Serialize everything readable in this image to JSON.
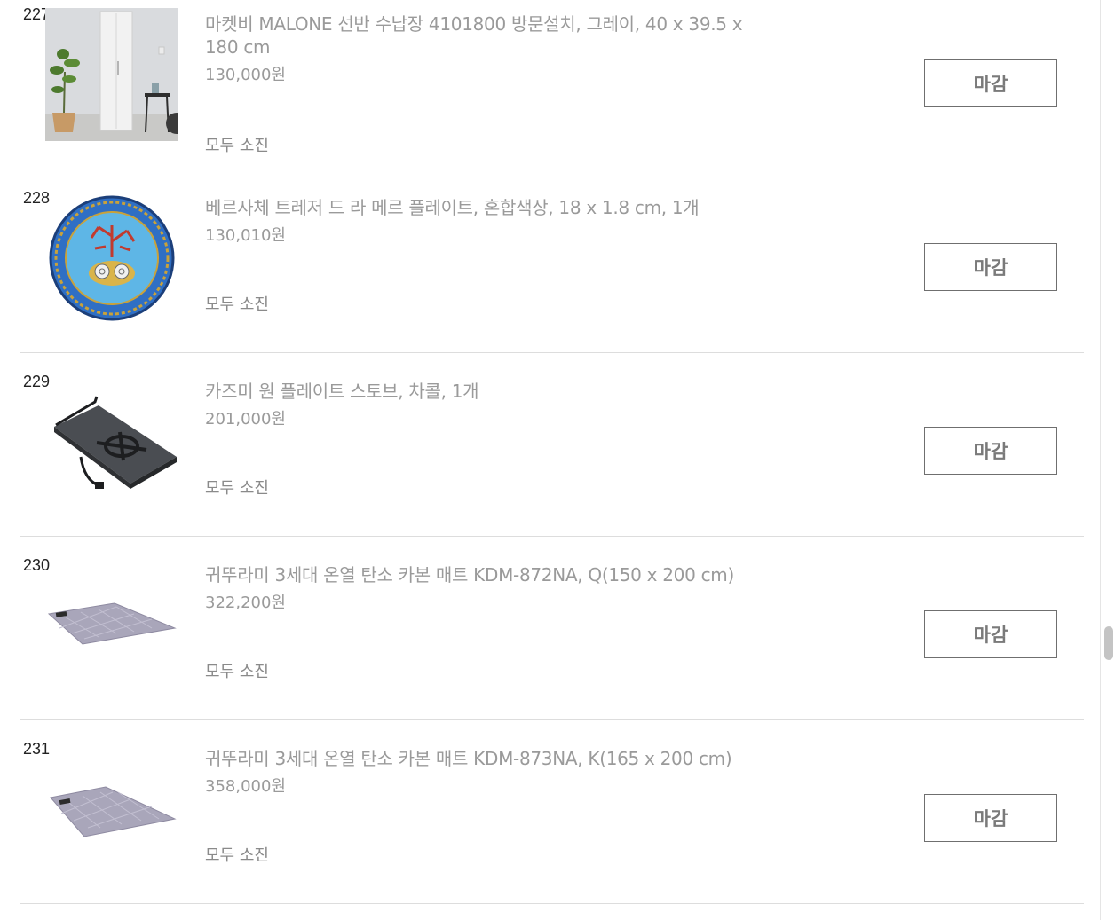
{
  "items": [
    {
      "number": "227",
      "title": "마켓비 MALONE 선반 수납장 4101800 방문설치, 그레이, 40 x 39.5 x 180 cm",
      "price": "130,000원",
      "status": "모두 소진",
      "button_label": "마감",
      "thumb": "cabinet-image"
    },
    {
      "number": "228",
      "title": "베르사체 트레저 드 라 메르 플레이트, 혼합색상, 18 x 1.8 cm, 1개",
      "price": "130,010원",
      "status": "모두 소진",
      "button_label": "마감",
      "thumb": "plate-image"
    },
    {
      "number": "229",
      "title": "카즈미 원 플레이트 스토브, 차콜, 1개",
      "price": "201,000원",
      "status": "모두 소진",
      "button_label": "마감",
      "thumb": "stove-image"
    },
    {
      "number": "230",
      "title": "귀뚜라미 3세대 온열 탄소 카본 매트 KDM-872NA, Q(150 x 200 cm)",
      "price": "322,200원",
      "status": "모두 소진",
      "button_label": "마감",
      "thumb": "mat-image"
    },
    {
      "number": "231",
      "title": "귀뚜라미 3세대 온열 탄소 카본 매트 KDM-873NA, K(165 x 200 cm)",
      "price": "358,000원",
      "status": "모두 소진",
      "button_label": "마감",
      "thumb": "mat-image"
    }
  ],
  "colors": {
    "text_muted": "#9a9a9a",
    "border": "#dddddd",
    "button_border": "#6f6f6f",
    "plate_blue": "#3a7fd6"
  }
}
